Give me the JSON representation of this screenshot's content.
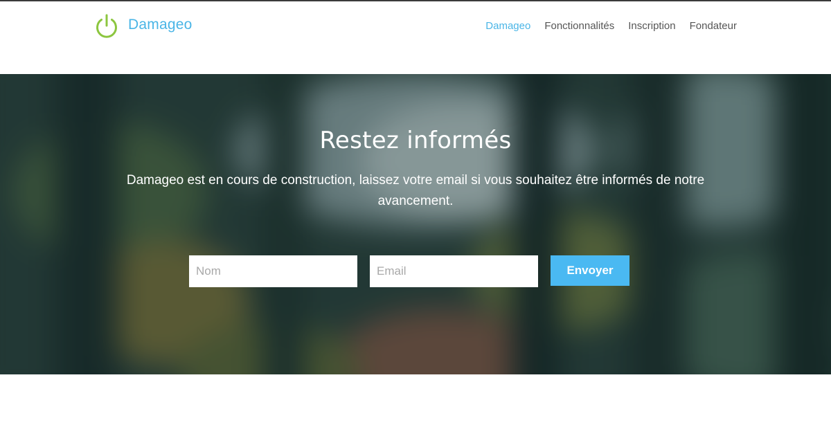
{
  "brand": {
    "name": "Damageo",
    "icon": "power-icon",
    "icon_color": "#8cc63f",
    "text_color": "#4ab5e6"
  },
  "nav": {
    "items": [
      {
        "label": "Damageo",
        "active": true
      },
      {
        "label": "Fonctionnalités",
        "active": false
      },
      {
        "label": "Inscription",
        "active": false
      },
      {
        "label": "Fondateur",
        "active": false
      }
    ]
  },
  "hero": {
    "title": "Restez informés",
    "text": "Damageo est en cours de construction, laissez votre email si vous souhaitez être informés de notre avancement."
  },
  "form": {
    "name_placeholder": "Nom",
    "email_placeholder": "Email",
    "submit_label": "Envoyer",
    "button_color": "#4ab9f2"
  }
}
